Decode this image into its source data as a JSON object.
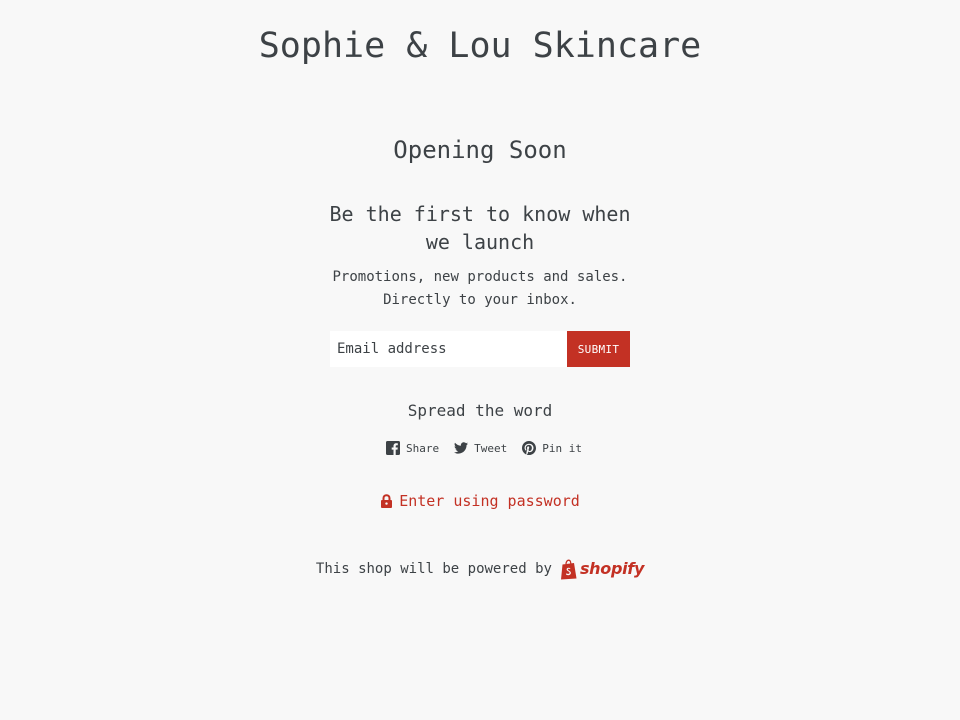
{
  "header": {
    "shop_title": "Sophie & Lou Skincare"
  },
  "main": {
    "opening_heading": "Opening Soon",
    "signup_heading": "Be the first to know when we launch",
    "signup_text": "Promotions, new products and sales. Directly to your inbox.",
    "email_placeholder": "Email address",
    "submit_label": "SUBMIT"
  },
  "share": {
    "heading": "Spread the word",
    "items": [
      {
        "label": "Share",
        "icon": "facebook-icon"
      },
      {
        "label": "Tweet",
        "icon": "twitter-icon"
      },
      {
        "label": "Pin it",
        "icon": "pinterest-icon"
      }
    ]
  },
  "password": {
    "link_label": "Enter using password",
    "icon": "lock-icon"
  },
  "footer": {
    "powered_text": "This shop will be powered by",
    "shopify_label": "shopify"
  },
  "colors": {
    "background": "#f8f8f8",
    "text": "#3d4246",
    "accent": "#c33124"
  }
}
